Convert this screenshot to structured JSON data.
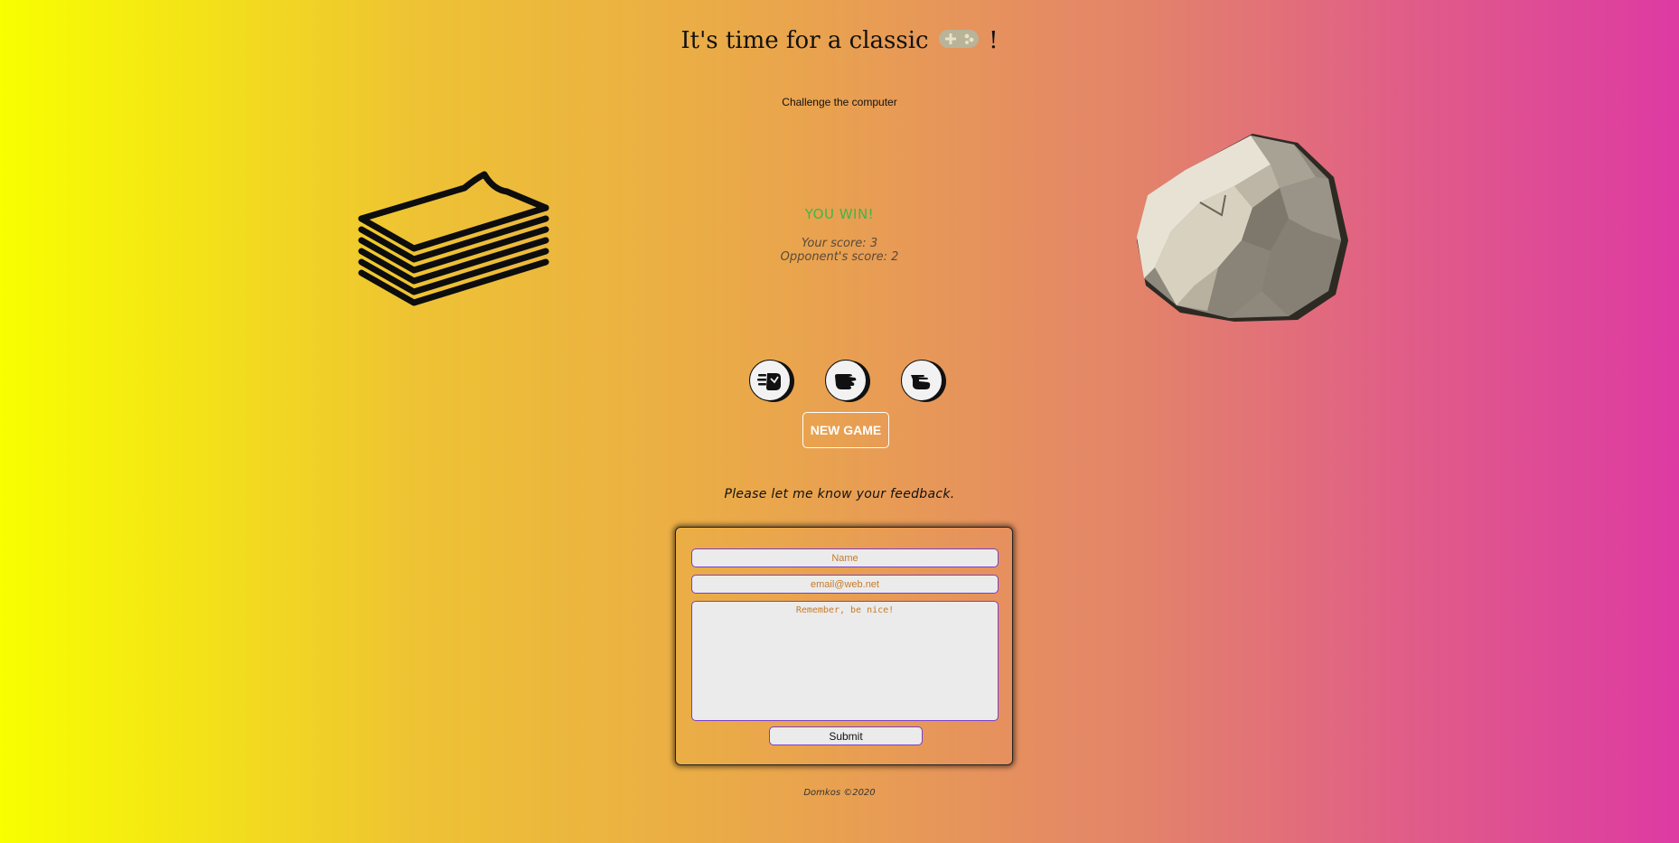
{
  "header": {
    "title_prefix": "It's time for a classic",
    "title_suffix": "!",
    "title_icon": "gamepad-icon",
    "subtitle": "Challenge the computer"
  },
  "game": {
    "player_choice_icon": "paper-stack-icon",
    "opponent_choice_icon": "rock-icon",
    "result_text": "YOU WIN!",
    "your_score_text": "Your score: 3",
    "opponent_score_text": "Opponent's score: 2",
    "result_color": "#3fb64a",
    "choices": [
      {
        "name": "rock-choice",
        "icon": "fist-icon"
      },
      {
        "name": "paper-choice",
        "icon": "open-hand-icon"
      },
      {
        "name": "scissors-choice",
        "icon": "scissors-hand-icon"
      }
    ],
    "new_game_label": "NEW GAME"
  },
  "feedback": {
    "heading": "Please let me know your feedback.",
    "name_placeholder": "Name",
    "email_placeholder": "email@web.net",
    "message_placeholder": "Remember, be nice!",
    "submit_label": "Submit",
    "field_border_color": "#7b3fc9",
    "placeholder_color": "#c77a28"
  },
  "footer": {
    "text": "Domkos ©2020"
  }
}
